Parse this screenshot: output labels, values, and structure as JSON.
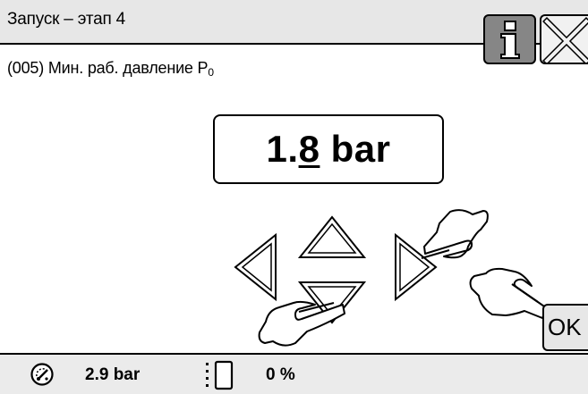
{
  "header": {
    "title": "Запуск – этап 4",
    "info_icon": "info-icon",
    "close_icon": "close-icon"
  },
  "parameter": {
    "label_main": "(005) Мин. раб. давление P",
    "label_sub": "0"
  },
  "value_display": {
    "prefix": "1.",
    "active_digit": "8",
    "unit": " bar"
  },
  "controls": {
    "left_icon": "arrow-left-icon",
    "up_icon": "arrow-up-icon",
    "down_icon": "arrow-down-icon",
    "right_icon": "arrow-right-icon",
    "ok_label": "OK"
  },
  "status_bar": {
    "pressure_icon": "pressure-gauge-icon",
    "pressure_value": "2.9 bar",
    "level_icon": "tank-level-icon",
    "level_value": "0 %",
    "level_fraction": 0
  },
  "colors": {
    "title_background": "#e7e7e7",
    "info_button": "#868686",
    "status_background": "#ebebeb",
    "ok_button": "#e7e7e7"
  }
}
